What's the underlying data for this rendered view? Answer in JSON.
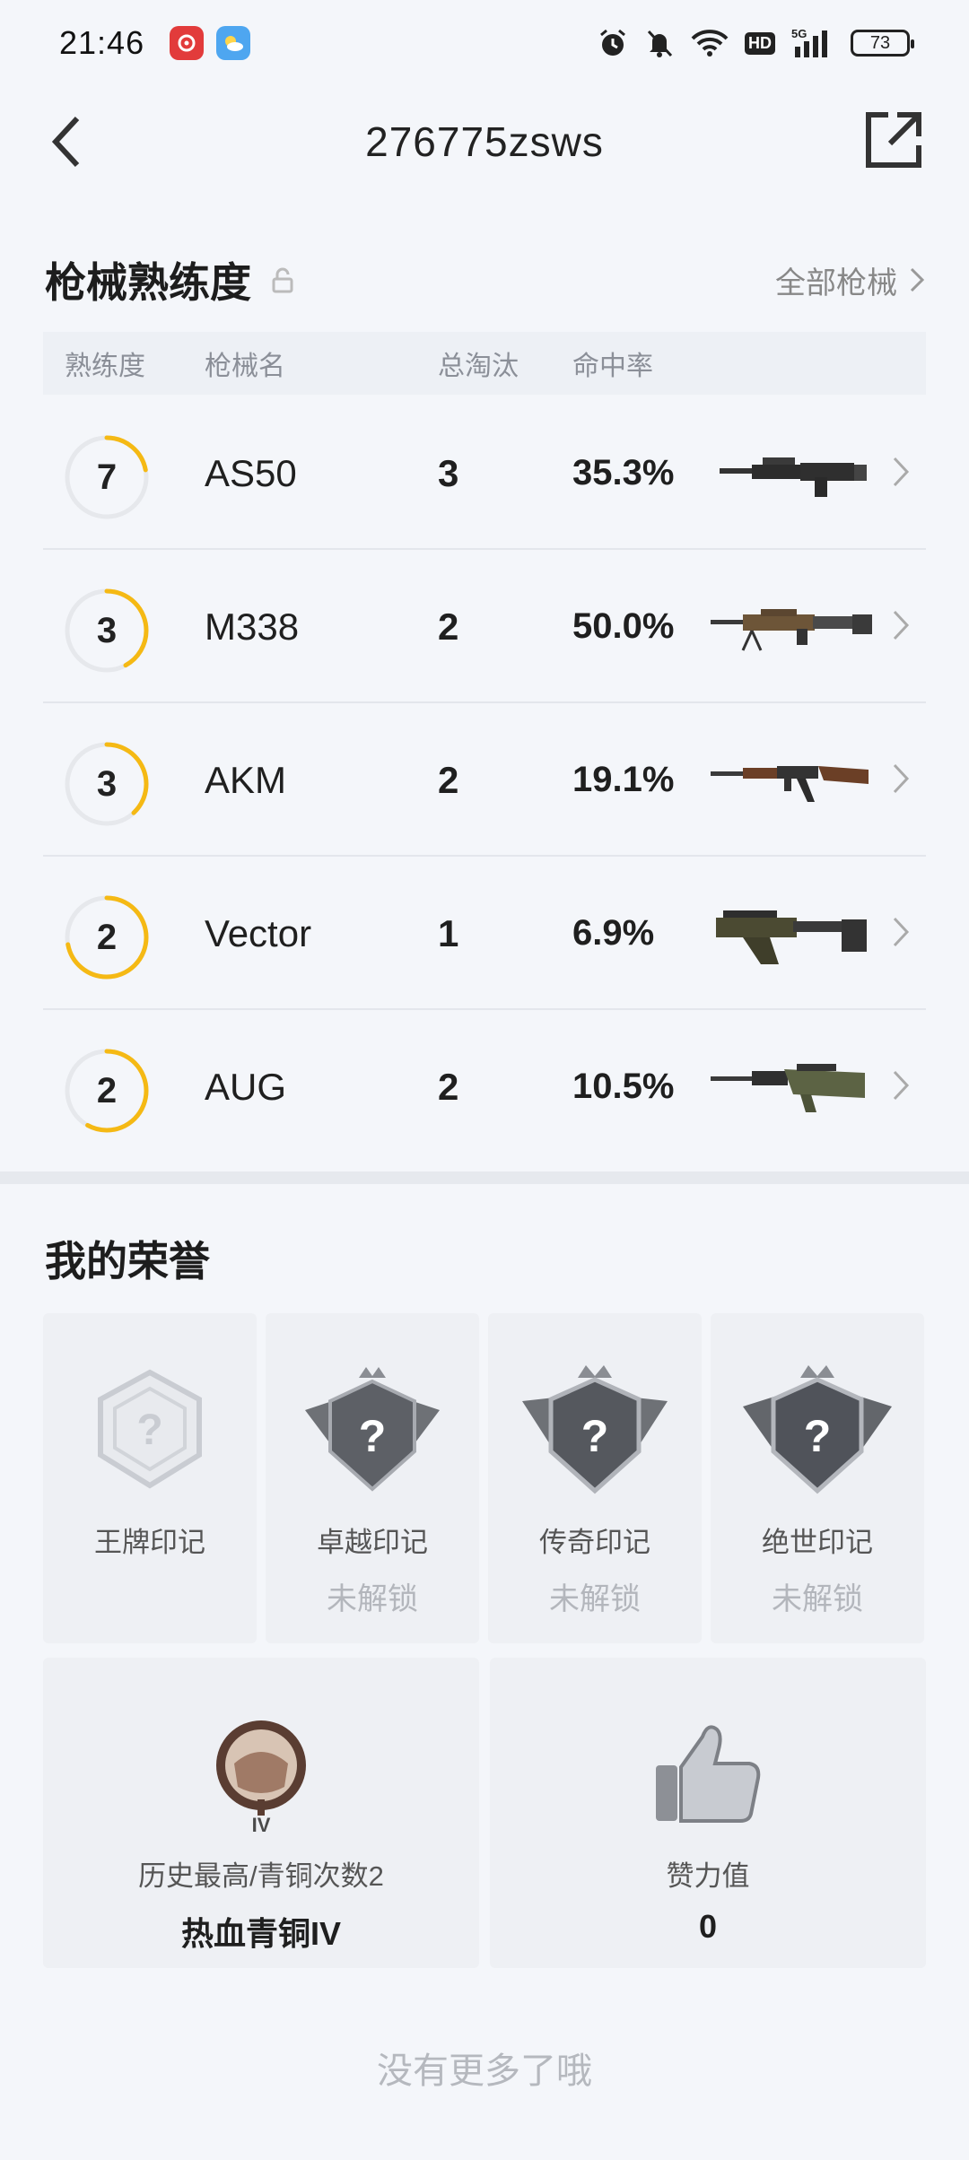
{
  "status_bar": {
    "time": "21:46",
    "battery": "73",
    "hd_label": "HD",
    "net_label": "5G"
  },
  "header": {
    "title": "276775zsws"
  },
  "weapons": {
    "section_title": "枪械熟练度",
    "all_link": "全部枪械",
    "columns": {
      "level": "熟练度",
      "name": "枪械名",
      "elims": "总淘汰",
      "rate": "命中率"
    },
    "rows": [
      {
        "level": "7",
        "progress": 0.22,
        "name": "AS50",
        "elims": "3",
        "rate": "35.3%"
      },
      {
        "level": "3",
        "progress": 0.42,
        "name": "M338",
        "elims": "2",
        "rate": "50.0%"
      },
      {
        "level": "3",
        "progress": 0.38,
        "name": "AKM",
        "elims": "2",
        "rate": "19.1%"
      },
      {
        "level": "2",
        "progress": 0.72,
        "name": "Vector",
        "elims": "1",
        "rate": "6.9%"
      },
      {
        "level": "2",
        "progress": 0.58,
        "name": "AUG",
        "elims": "2",
        "rate": "10.5%"
      }
    ],
    "ring_color": "#f5b914"
  },
  "honor": {
    "section_title": "我的荣誉",
    "cards": [
      {
        "name": "王牌印记",
        "status": ""
      },
      {
        "name": "卓越印记",
        "status": "未解锁"
      },
      {
        "name": "传奇印记",
        "status": "未解锁"
      },
      {
        "name": "绝世印记",
        "status": "未解锁"
      }
    ],
    "rank": {
      "label": "历史最高/青铜次数2",
      "value": "热血青铜IV",
      "tier_mark": "IV"
    },
    "likes": {
      "label": "赞力值",
      "value": "0"
    }
  },
  "footer": {
    "text": "没有更多了哦"
  }
}
